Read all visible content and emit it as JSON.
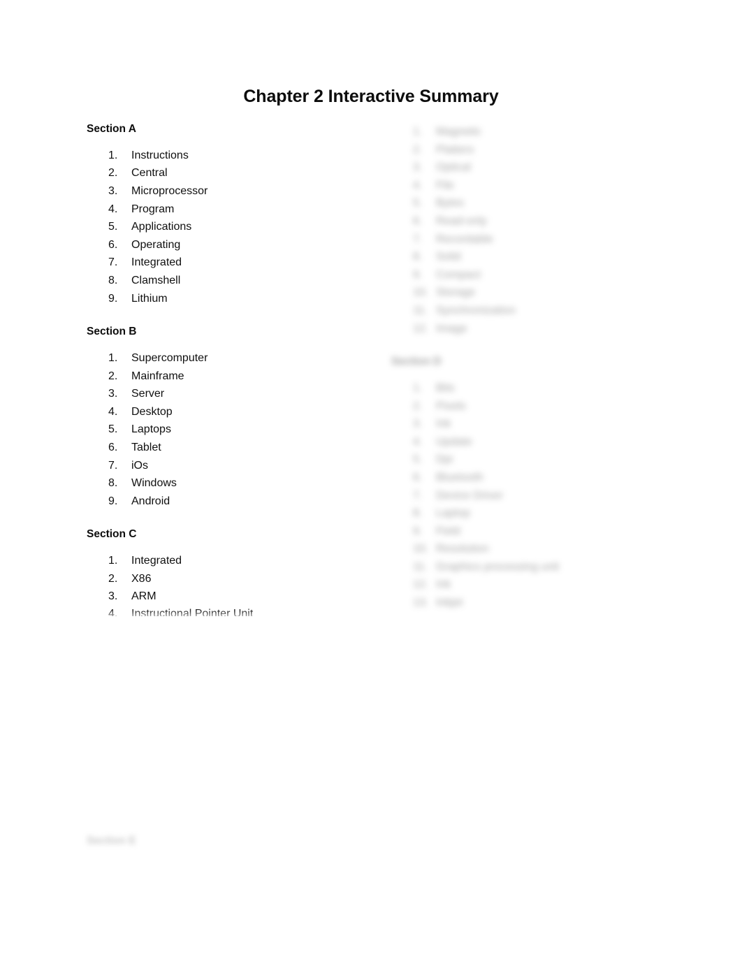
{
  "document": {
    "title": "Chapter 2 Interactive Summary",
    "page_background": "#ffffff",
    "text_color": "#101010"
  },
  "left_column": {
    "sections": [
      {
        "heading": "Section A",
        "items": [
          "Instructions",
          "Central",
          "Microprocessor",
          "Program",
          "Applications",
          "Operating",
          "Integrated",
          "Clamshell",
          "Lithium"
        ]
      },
      {
        "heading": "Section B",
        "items": [
          "Supercomputer",
          "Mainframe",
          "Server",
          "Desktop",
          "Laptops",
          "Tablet",
          "iOs",
          "Windows",
          "Android"
        ]
      },
      {
        "heading": "Section C",
        "items": [
          "Integrated",
          "X86",
          "ARM"
        ]
      }
    ],
    "clipped_item": {
      "number": "4.",
      "text": "Instructional Pointer Unit"
    },
    "faint_bottom_heading": "Section E"
  },
  "right_column": {
    "obscured": true,
    "blocks": [
      {
        "heading": "",
        "items": [
          "Magnetic",
          "Platters",
          "Optical",
          "File",
          "Bytes",
          "Read-only",
          "Recordable",
          "Solid",
          "Compact",
          "Storage",
          "Synchronization",
          "Image"
        ]
      },
      {
        "heading": "Section D",
        "items": [
          "Bits",
          "Pixels",
          "Ink",
          "Update",
          "Dpi",
          "Bluetooth",
          "Device Driver",
          "Laptop",
          "Field",
          "Resolution",
          "Graphics processing unit",
          "Ink",
          "Inkjet"
        ]
      }
    ]
  }
}
